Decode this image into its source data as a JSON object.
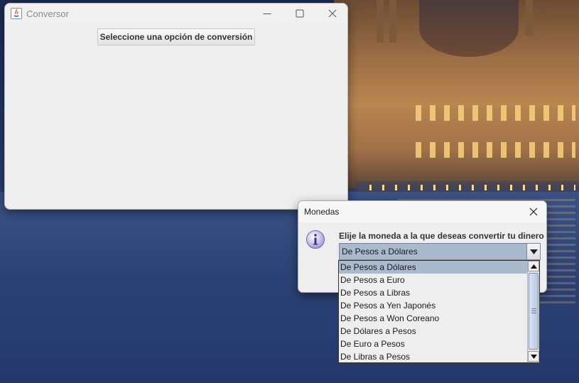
{
  "main_window": {
    "title": "Conversor",
    "option_button_label": "Seleccione una opción de conversión"
  },
  "dialog": {
    "title": "Monedas",
    "message": "Elije la moneda a la que deseas convertir tu dinero",
    "selected_value": "De Pesos a Dólares",
    "options": [
      "De Pesos a Dólares",
      "De Pesos a Euro",
      "De Pesos a Libras",
      "De Pesos a Yen Japonés",
      "De Pesos a Won Coreano",
      "De Dólares a Pesos",
      "De Euro a Pesos",
      "De Libras a Pesos"
    ]
  },
  "icons": {
    "app": "java-app-icon",
    "minimize": "minimize-icon",
    "maximize": "maximize-icon",
    "close": "close-icon",
    "info": "info-icon",
    "dropdown": "chevron-down-icon"
  },
  "colors": {
    "selection": "#a9bacf",
    "window_bg": "#eeeeee",
    "info_icon": "#8f86c8"
  }
}
